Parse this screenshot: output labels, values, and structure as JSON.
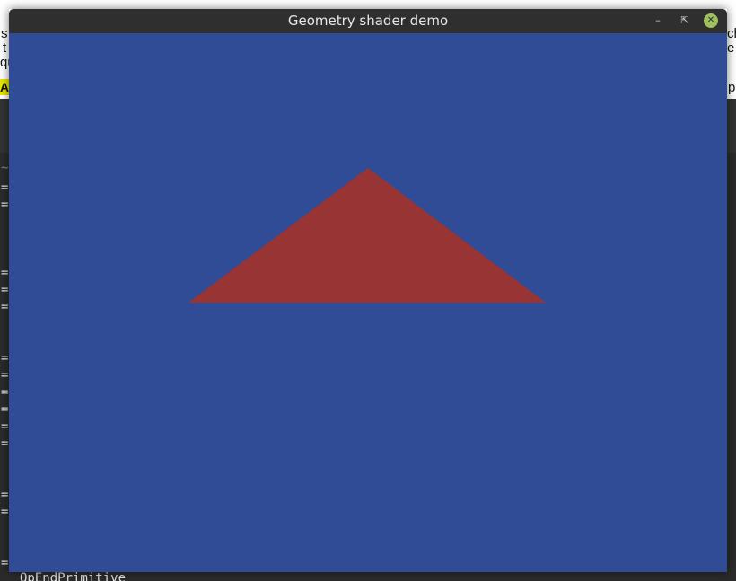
{
  "window": {
    "title": "Geometry shader demo",
    "controls": {
      "minimize_icon": "minimize-icon",
      "maximize_icon": "maximize-icon",
      "close_icon": "close-icon"
    }
  },
  "viewport": {
    "clear_color": "#314c96",
    "triangle_color": "#983434"
  },
  "background": {
    "web_edges": {
      "left": [
        "s",
        "t",
        "qu"
      ],
      "right": [
        "ch",
        "e t"
      ],
      "highlight_left": "Ar",
      "highlight_right": "p"
    },
    "terminal": {
      "tilde": "~",
      "marker": "=",
      "last_line": "OpEndPrimitive"
    }
  }
}
